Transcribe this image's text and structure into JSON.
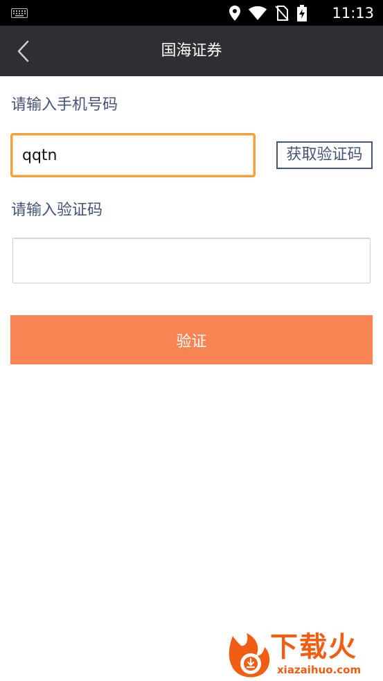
{
  "status_bar": {
    "time": "11:13",
    "icons": [
      "keyboard-icon",
      "location-icon",
      "wifi-icon",
      "no-sim-icon",
      "battery-charging-icon"
    ]
  },
  "app_bar": {
    "title": "国海证券",
    "back_icon": "chevron-left-icon"
  },
  "form": {
    "phone_label": "请输入手机号码",
    "phone_value": "qqtn",
    "get_code_label": "获取验证码",
    "code_label": "请输入验证码",
    "code_value": "",
    "verify_label": "验证"
  },
  "watermark": {
    "name": "下载火",
    "url": "xiazaihuo.com"
  },
  "colors": {
    "status_bar": "#000000",
    "app_bar": "#2e2f33",
    "label_text": "#44537a",
    "focus_border": "#f0a23b",
    "verify_button": "#f88454",
    "watermark": "#f25d14"
  }
}
